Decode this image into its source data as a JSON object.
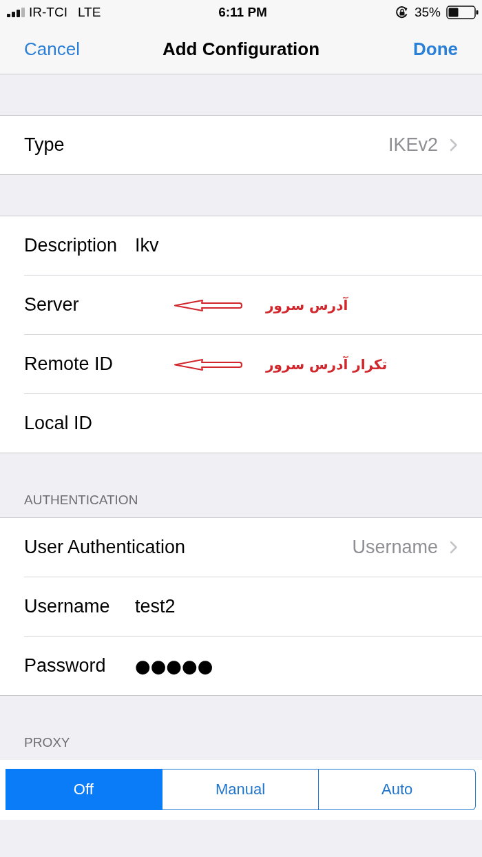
{
  "status_bar": {
    "carrier": "IR-TCI",
    "network": "LTE",
    "time": "6:11 PM",
    "battery": "35%"
  },
  "nav_bar": {
    "cancel": "Cancel",
    "title": "Add Configuration",
    "done": "Done"
  },
  "sections": [
    {
      "rows": [
        {
          "kind": "disclosure",
          "label": "Type",
          "value": "IKEv2"
        }
      ]
    },
    {
      "rows": [
        {
          "kind": "field",
          "label": "Description",
          "value": "Ikv"
        },
        {
          "kind": "field",
          "label": "Server",
          "annotation": "آدرس سرور"
        },
        {
          "kind": "field",
          "label": "Remote ID",
          "annotation": "تکرار آدرس سرور"
        },
        {
          "kind": "field",
          "label": "Local ID"
        }
      ]
    },
    {
      "header": "AUTHENTICATION",
      "rows": [
        {
          "kind": "disclosure",
          "label": "User Authentication",
          "value": "Username"
        },
        {
          "kind": "field",
          "label": "Username",
          "value": "test2"
        },
        {
          "kind": "secure",
          "label": "Password",
          "value": "●●●●●"
        }
      ]
    },
    {
      "header": "PROXY",
      "segments": [
        {
          "label": "Off",
          "selected": true
        },
        {
          "label": "Manual",
          "selected": false
        },
        {
          "label": "Auto",
          "selected": false
        }
      ]
    }
  ]
}
